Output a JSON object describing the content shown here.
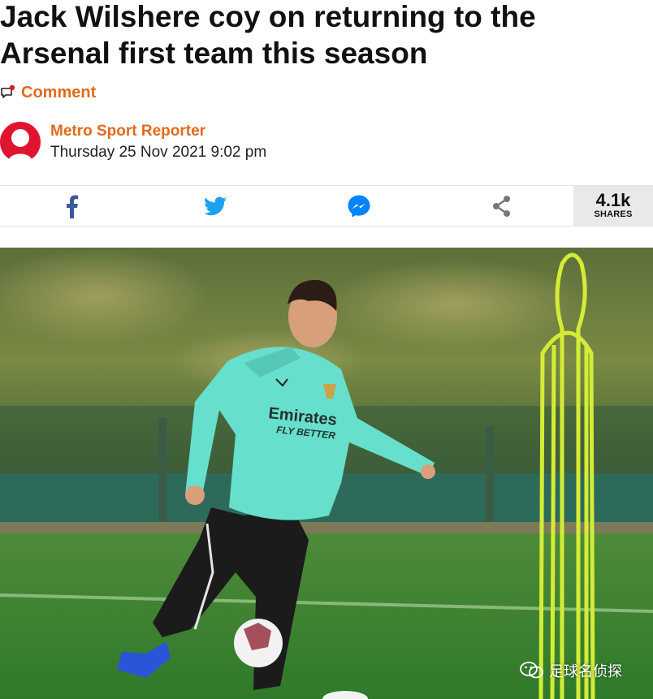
{
  "article": {
    "headline": "Jack Wilshere coy on returning to the Arsenal first team this season",
    "comment_label": "Comment",
    "author": "Metro Sport Reporter",
    "date": "Thursday 25 Nov 2021 9:02 pm"
  },
  "share": {
    "buttons": [
      "facebook-icon",
      "twitter-icon",
      "messenger-icon",
      "share-icon"
    ],
    "count": "4.1k",
    "count_label": "SHARES"
  },
  "photo": {
    "shirt_text_1": "Emirates",
    "shirt_text_2": "FLY BETTER"
  },
  "watermark": {
    "text": "足球名侦探"
  },
  "colors": {
    "accent": "#e36a1b",
    "facebook": "#3b5998",
    "twitter": "#1da1f2",
    "messenger": "#0084ff",
    "share": "#777777",
    "avatar": "#e0142f"
  }
}
